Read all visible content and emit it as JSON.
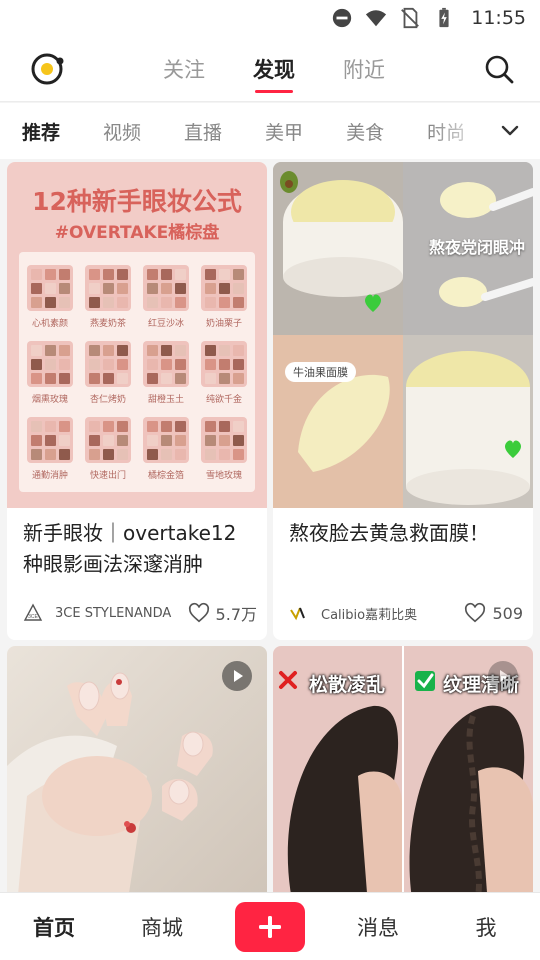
{
  "status_bar": {
    "time": "11:55"
  },
  "top_nav": {
    "tabs": [
      {
        "label": "关注"
      },
      {
        "label": "发现"
      },
      {
        "label": "附近"
      }
    ]
  },
  "categories": {
    "items": [
      "推荐",
      "视频",
      "直播",
      "美甲",
      "美食",
      "时尚"
    ]
  },
  "feed": [
    {
      "title": "新手眼妆｜overtake12种眼影画法深邃消肿",
      "author": "3CE STYLENANDA",
      "likes": "5.7万",
      "cover_title": "12种新手眼妆公式",
      "cover_subtitle": "#OVERTAKE橘棕盘",
      "looks": [
        "心机素颜",
        "燕麦奶茶",
        "红豆沙冰",
        "奶油栗子",
        "烟熏玫瑰",
        "杏仁烤奶",
        "甜橙玉土",
        "纯欲千金",
        "通勤消肿",
        "快速出门",
        "橘棕金箔",
        "雪地玫瑰"
      ]
    },
    {
      "title": "熬夜脸去黄急救面膜！",
      "author": "Calibio嘉莉比奥",
      "likes": "509",
      "cover_overlay": "熬夜党闭眼冲",
      "cover_tag": "牛油果面膜"
    },
    {
      "cover_overlay": ""
    },
    {
      "cover_left_label": "松散凌乱",
      "cover_right_label": "纹理清晰"
    }
  ],
  "bottom_nav": {
    "items": [
      "首页",
      "商城",
      "消息",
      "我"
    ]
  },
  "colors": {
    "accent": "#ff2442",
    "cover_pink": "#f2ccc7",
    "mask_yellow": "#f4edc0"
  }
}
